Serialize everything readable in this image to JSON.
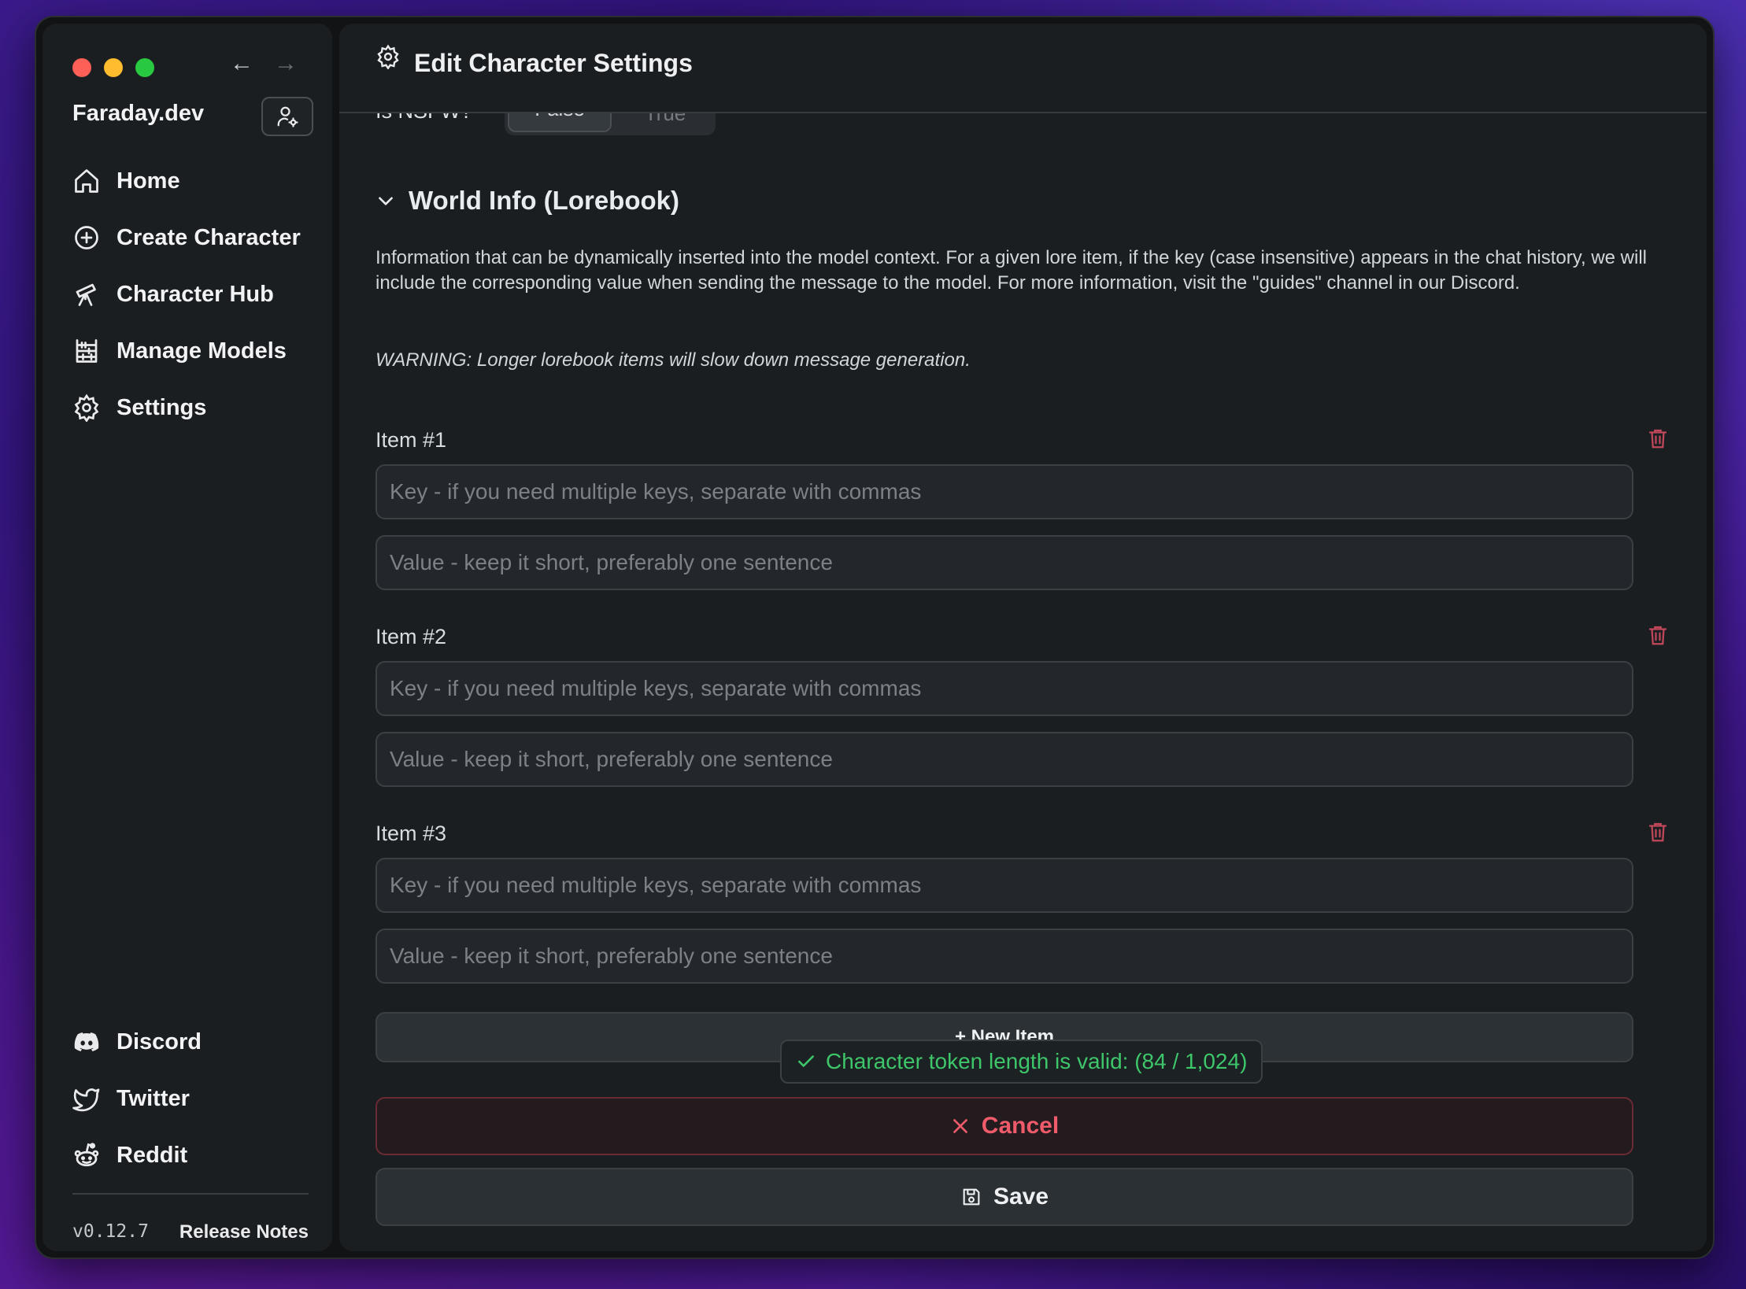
{
  "app": {
    "brand": "Faraday.dev"
  },
  "sidebar": {
    "items": [
      {
        "label": "Home",
        "icon": "home-icon"
      },
      {
        "label": "Create Character",
        "icon": "plus-circle-icon"
      },
      {
        "label": "Character Hub",
        "icon": "telescope-icon"
      },
      {
        "label": "Manage Models",
        "icon": "abacus-icon"
      },
      {
        "label": "Settings",
        "icon": "gear-icon"
      }
    ],
    "social": [
      {
        "label": "Discord",
        "icon": "discord-icon"
      },
      {
        "label": "Twitter",
        "icon": "twitter-icon"
      },
      {
        "label": "Reddit",
        "icon": "reddit-icon"
      }
    ],
    "version": "v0.12.7",
    "release_notes": "Release Notes"
  },
  "header": {
    "title": "Edit Character Settings"
  },
  "nsfw": {
    "label": "Is NSFW?",
    "options": [
      "False",
      "True"
    ],
    "selected": "False"
  },
  "lorebook": {
    "title": "World Info (Lorebook)",
    "description": "Information that can be dynamically inserted into the model context. For a given lore item, if the key (case insensitive) appears in the chat history, we will include the corresponding value when sending the message to the model. For more information, visit the \"guides\" channel in our Discord.",
    "warning": "WARNING: Longer lorebook items will slow down message generation.",
    "key_placeholder": "Key - if you need multiple keys, separate with commas",
    "value_placeholder": "Value - keep it short, preferably one sentence",
    "items": [
      {
        "label": "Item #1",
        "key": "",
        "value": ""
      },
      {
        "label": "Item #2",
        "key": "",
        "value": ""
      },
      {
        "label": "Item #3",
        "key": "",
        "value": ""
      }
    ],
    "new_item_label": "+ New Item"
  },
  "status": {
    "token_message": "Character token length is valid: (84 / 1,024)",
    "color": "#3ec66a"
  },
  "actions": {
    "cancel_label": "Cancel",
    "save_label": "Save"
  },
  "colors": {
    "danger": "#ef5b6b",
    "success": "#3ec66a",
    "trash": "#c0485a"
  }
}
